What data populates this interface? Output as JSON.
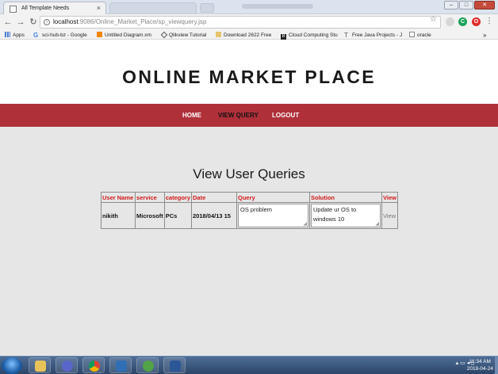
{
  "browser": {
    "tab_title": "All Template Needs",
    "tab_close": "×",
    "address_host": "localhost",
    "address_path": ":9086/Online_Market_Place/sp_viewquery.jsp",
    "bookmarks": [
      {
        "label": "Apps",
        "icon": "apps-icon"
      },
      {
        "label": "sci-hub-bz - Google",
        "icon": "google-icon"
      },
      {
        "label": "Untitled Diagram.xm",
        "icon": "diagram-icon"
      },
      {
        "label": "Qlikview Tutorial",
        "icon": "qlik-icon"
      },
      {
        "label": "Download 2622 Free",
        "icon": "folder-icon"
      },
      {
        "label": "Cloud Computing Stu",
        "icon": "bookmark-b-icon"
      },
      {
        "label": "Free Java Projects - J",
        "icon": "text-icon"
      },
      {
        "label": "oracle",
        "icon": "page-icon"
      }
    ],
    "bookmarks_overflow": "»"
  },
  "site": {
    "title": "ONLINE MARKET PLACE",
    "nav": [
      {
        "label": "HOME"
      },
      {
        "label": "VIEW QUERY"
      },
      {
        "label": "LOGOUT"
      }
    ],
    "heading": "View User Queries"
  },
  "table": {
    "headers": [
      "User Name",
      "service",
      "category",
      "Date",
      "Query",
      "Solution",
      "View"
    ],
    "rows": [
      {
        "user_name": "nikith",
        "service": "Microsoft",
        "category": "PCs",
        "date": "2018/04/13 15",
        "query": "OS problem",
        "solution": "Update ur OS to windows 10",
        "view": "View"
      }
    ]
  },
  "taskbar": {
    "time": "11:34 AM",
    "date": "2018-04-24"
  },
  "colors": {
    "navbar": "#b0303a",
    "header_text": "#d21a1a",
    "page_bg": "#e6e6e6"
  }
}
